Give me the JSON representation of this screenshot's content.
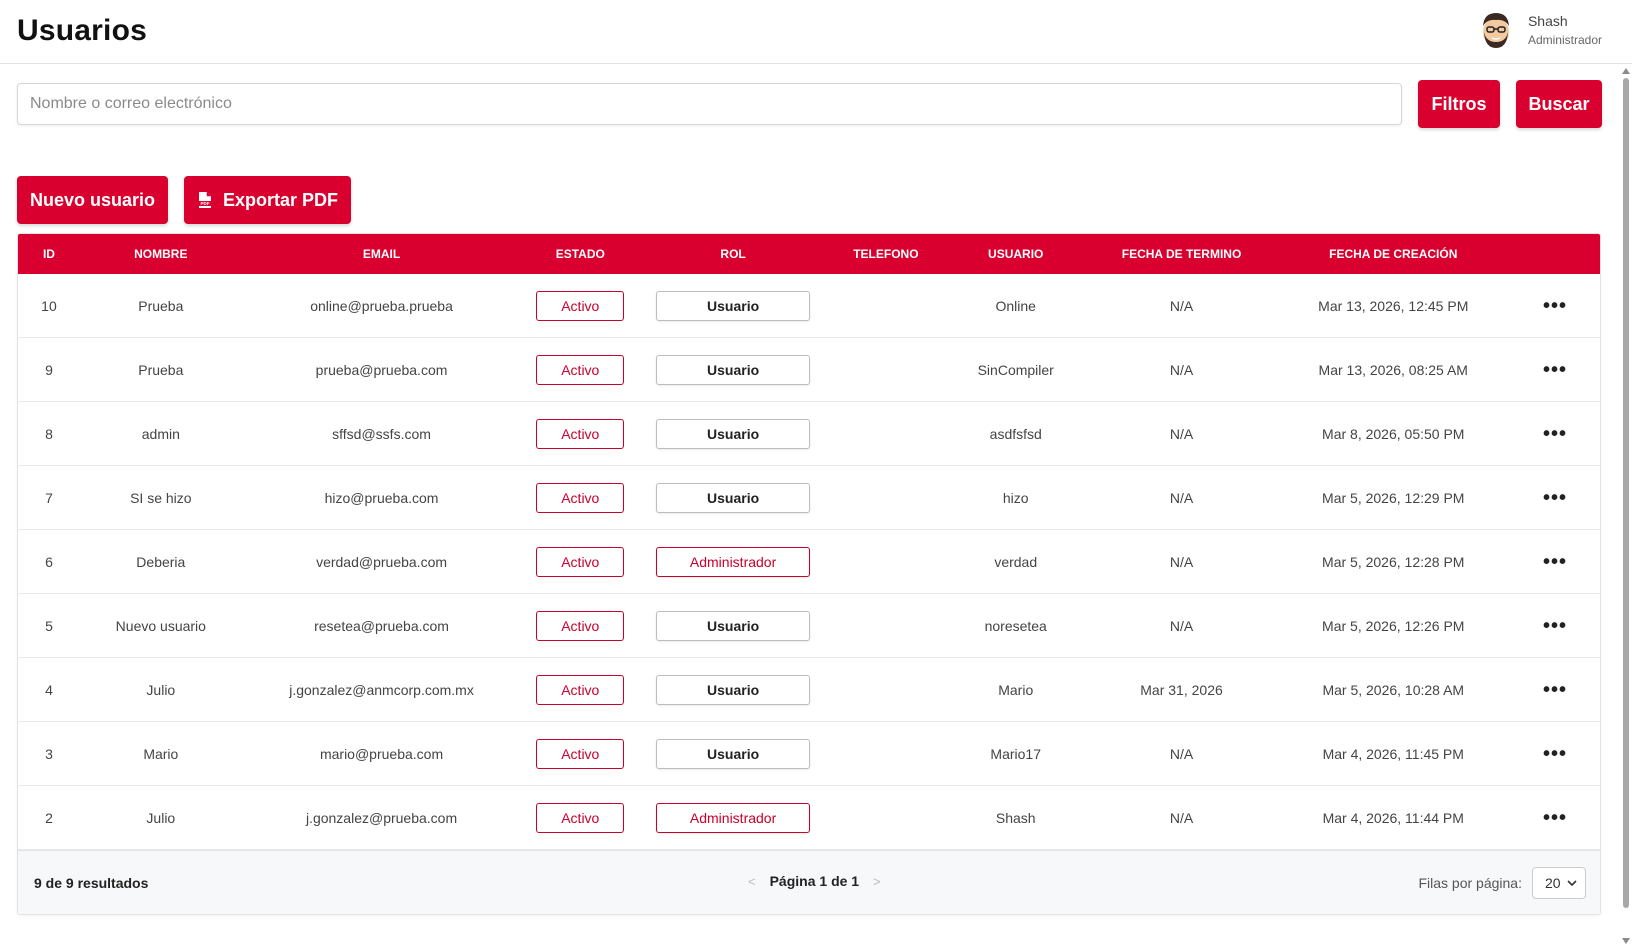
{
  "header": {
    "title": "Usuarios",
    "user_name": "Shash",
    "user_role": "Administrador"
  },
  "search": {
    "placeholder": "Nombre o correo electrónico",
    "value": "",
    "filters_label": "Filtros",
    "search_label": "Buscar"
  },
  "actions": {
    "new_user_label": "Nuevo usuario",
    "export_pdf_label": "Exportar PDF"
  },
  "table": {
    "headers": {
      "id": "ID",
      "nombre": "NOMBRE",
      "email": "EMAIL",
      "estado": "ESTADO",
      "rol": "ROL",
      "telefono": "TELEFONO",
      "usuario": "USUARIO",
      "fecha_termino": "FECHA DE TERMINO",
      "fecha_creacion": "FECHA DE CREACIÓN"
    },
    "rows": [
      {
        "id": "10",
        "nombre": "Prueba",
        "email": "online@prueba.prueba",
        "estado": "Activo",
        "rol": "Usuario",
        "telefono": "",
        "usuario": "Online",
        "fecha_termino": "N/A",
        "fecha_creacion": "Mar 13, 2026, 12:45 PM"
      },
      {
        "id": "9",
        "nombre": "Prueba",
        "email": "prueba@prueba.com",
        "estado": "Activo",
        "rol": "Usuario",
        "telefono": "",
        "usuario": "SinCompiler",
        "fecha_termino": "N/A",
        "fecha_creacion": "Mar 13, 2026, 08:25 AM"
      },
      {
        "id": "8",
        "nombre": "admin",
        "email": "sffsd@ssfs.com",
        "estado": "Activo",
        "rol": "Usuario",
        "telefono": "",
        "usuario": "asdfsfsd",
        "fecha_termino": "N/A",
        "fecha_creacion": "Mar 8, 2026, 05:50 PM"
      },
      {
        "id": "7",
        "nombre": "SI se hizo",
        "email": "hizo@prueba.com",
        "estado": "Activo",
        "rol": "Usuario",
        "telefono": "",
        "usuario": "hizo",
        "fecha_termino": "N/A",
        "fecha_creacion": "Mar 5, 2026, 12:29 PM"
      },
      {
        "id": "6",
        "nombre": "Deberia",
        "email": "verdad@prueba.com",
        "estado": "Activo",
        "rol": "Administrador",
        "telefono": "",
        "usuario": "verdad",
        "fecha_termino": "N/A",
        "fecha_creacion": "Mar 5, 2026, 12:28 PM"
      },
      {
        "id": "5",
        "nombre": "Nuevo usuario",
        "email": "resetea@prueba.com",
        "estado": "Activo",
        "rol": "Usuario",
        "telefono": "",
        "usuario": "noresetea",
        "fecha_termino": "N/A",
        "fecha_creacion": "Mar 5, 2026, 12:26 PM"
      },
      {
        "id": "4",
        "nombre": "Julio",
        "email": "j.gonzalez@anmcorp.com.mx",
        "estado": "Activo",
        "rol": "Usuario",
        "telefono": "",
        "usuario": "Mario",
        "fecha_termino": "Mar 31, 2026",
        "fecha_creacion": "Mar 5, 2026, 10:28 AM"
      },
      {
        "id": "3",
        "nombre": "Mario",
        "email": "mario@prueba.com",
        "estado": "Activo",
        "rol": "Usuario",
        "telefono": "",
        "usuario": "Mario17",
        "fecha_termino": "N/A",
        "fecha_creacion": "Mar 4, 2026, 11:45 PM"
      },
      {
        "id": "2",
        "nombre": "Julio",
        "email": "j.gonzalez@prueba.com",
        "estado": "Activo",
        "rol": "Administrador",
        "telefono": "",
        "usuario": "Shash",
        "fecha_termino": "N/A",
        "fecha_creacion": "Mar 4, 2026, 11:44 PM"
      }
    ],
    "row_action_icon": "more-horizontal-icon"
  },
  "footer": {
    "results_text": "9 de 9 resultados",
    "page_label": "Página 1 de 1",
    "rows_per_page_label": "Filas por página:",
    "rows_per_page_value": "20"
  },
  "colors": {
    "brand_red": "#d9002f",
    "badge_red": "#c8002b"
  }
}
